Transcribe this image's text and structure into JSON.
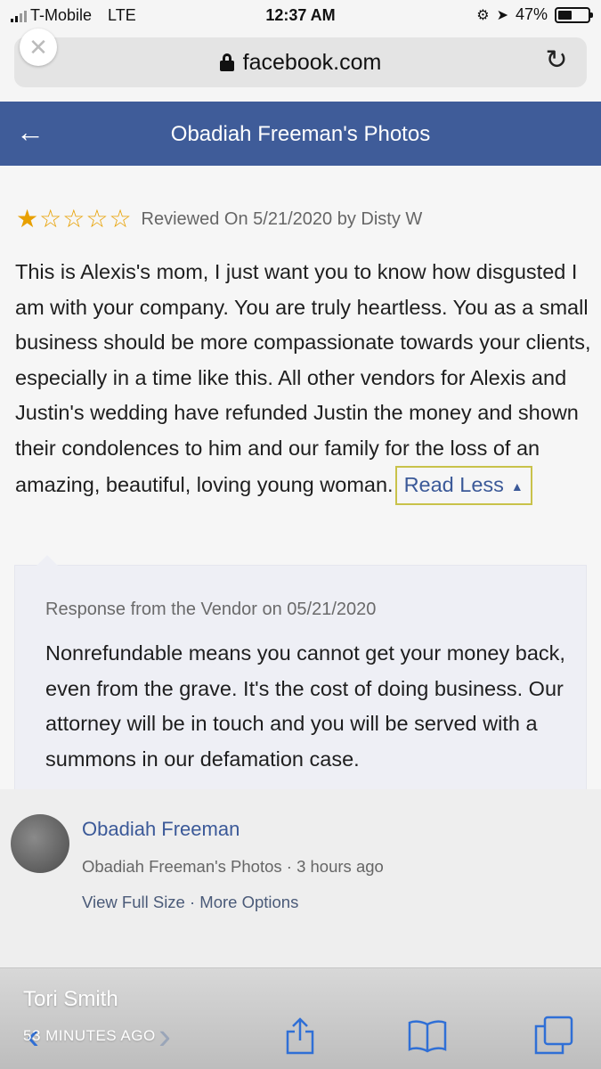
{
  "status_bar": {
    "carrier": "T-Mobile",
    "network": "LTE",
    "time": "12:37 AM",
    "battery": "47%",
    "battery_level": 0.47
  },
  "browser": {
    "url": "facebook.com",
    "close_icon": "close-icon",
    "reload_icon": "reload-icon"
  },
  "header": {
    "title": "Obadiah Freeman's Photos",
    "back_icon": "back-arrow-icon"
  },
  "review": {
    "rating": 1,
    "rating_max": 5,
    "meta": "Reviewed On 5/21/2020 by Disty W",
    "text": "This is Alexis's mom, I just want you to know how disgusted I am with your company. You are truly heartless. You as a small business should be more compassionate towards your clients, especially in a time like this. All other vendors for Alexis and Justin's wedding have refunded Justin the money and shown their condolences to him and our family for the loss of an amazing, beautiful, loving young woman.",
    "read_less": "Read Less"
  },
  "vendor_response": {
    "meta": "Response from the Vendor on 05/21/2020",
    "text": "Nonrefundable means you cannot get your money back, even from the grave. It's the cost of doing business. Our attorney will be in touch and you will be served with a summons in our defamation case."
  },
  "post": {
    "author": "Obadiah Freeman",
    "album": "Obadiah Freeman's Photos",
    "separator": " · ",
    "time": "3 hours ago",
    "view_full_size": "View Full Size",
    "more_options": "More Options"
  },
  "story": {
    "name": "Tori Smith",
    "time": "53 MINUTES AGO"
  },
  "toolbar": {
    "icons": [
      "back-icon",
      "forward-icon",
      "share-icon",
      "bookmarks-icon",
      "tabs-icon"
    ]
  }
}
